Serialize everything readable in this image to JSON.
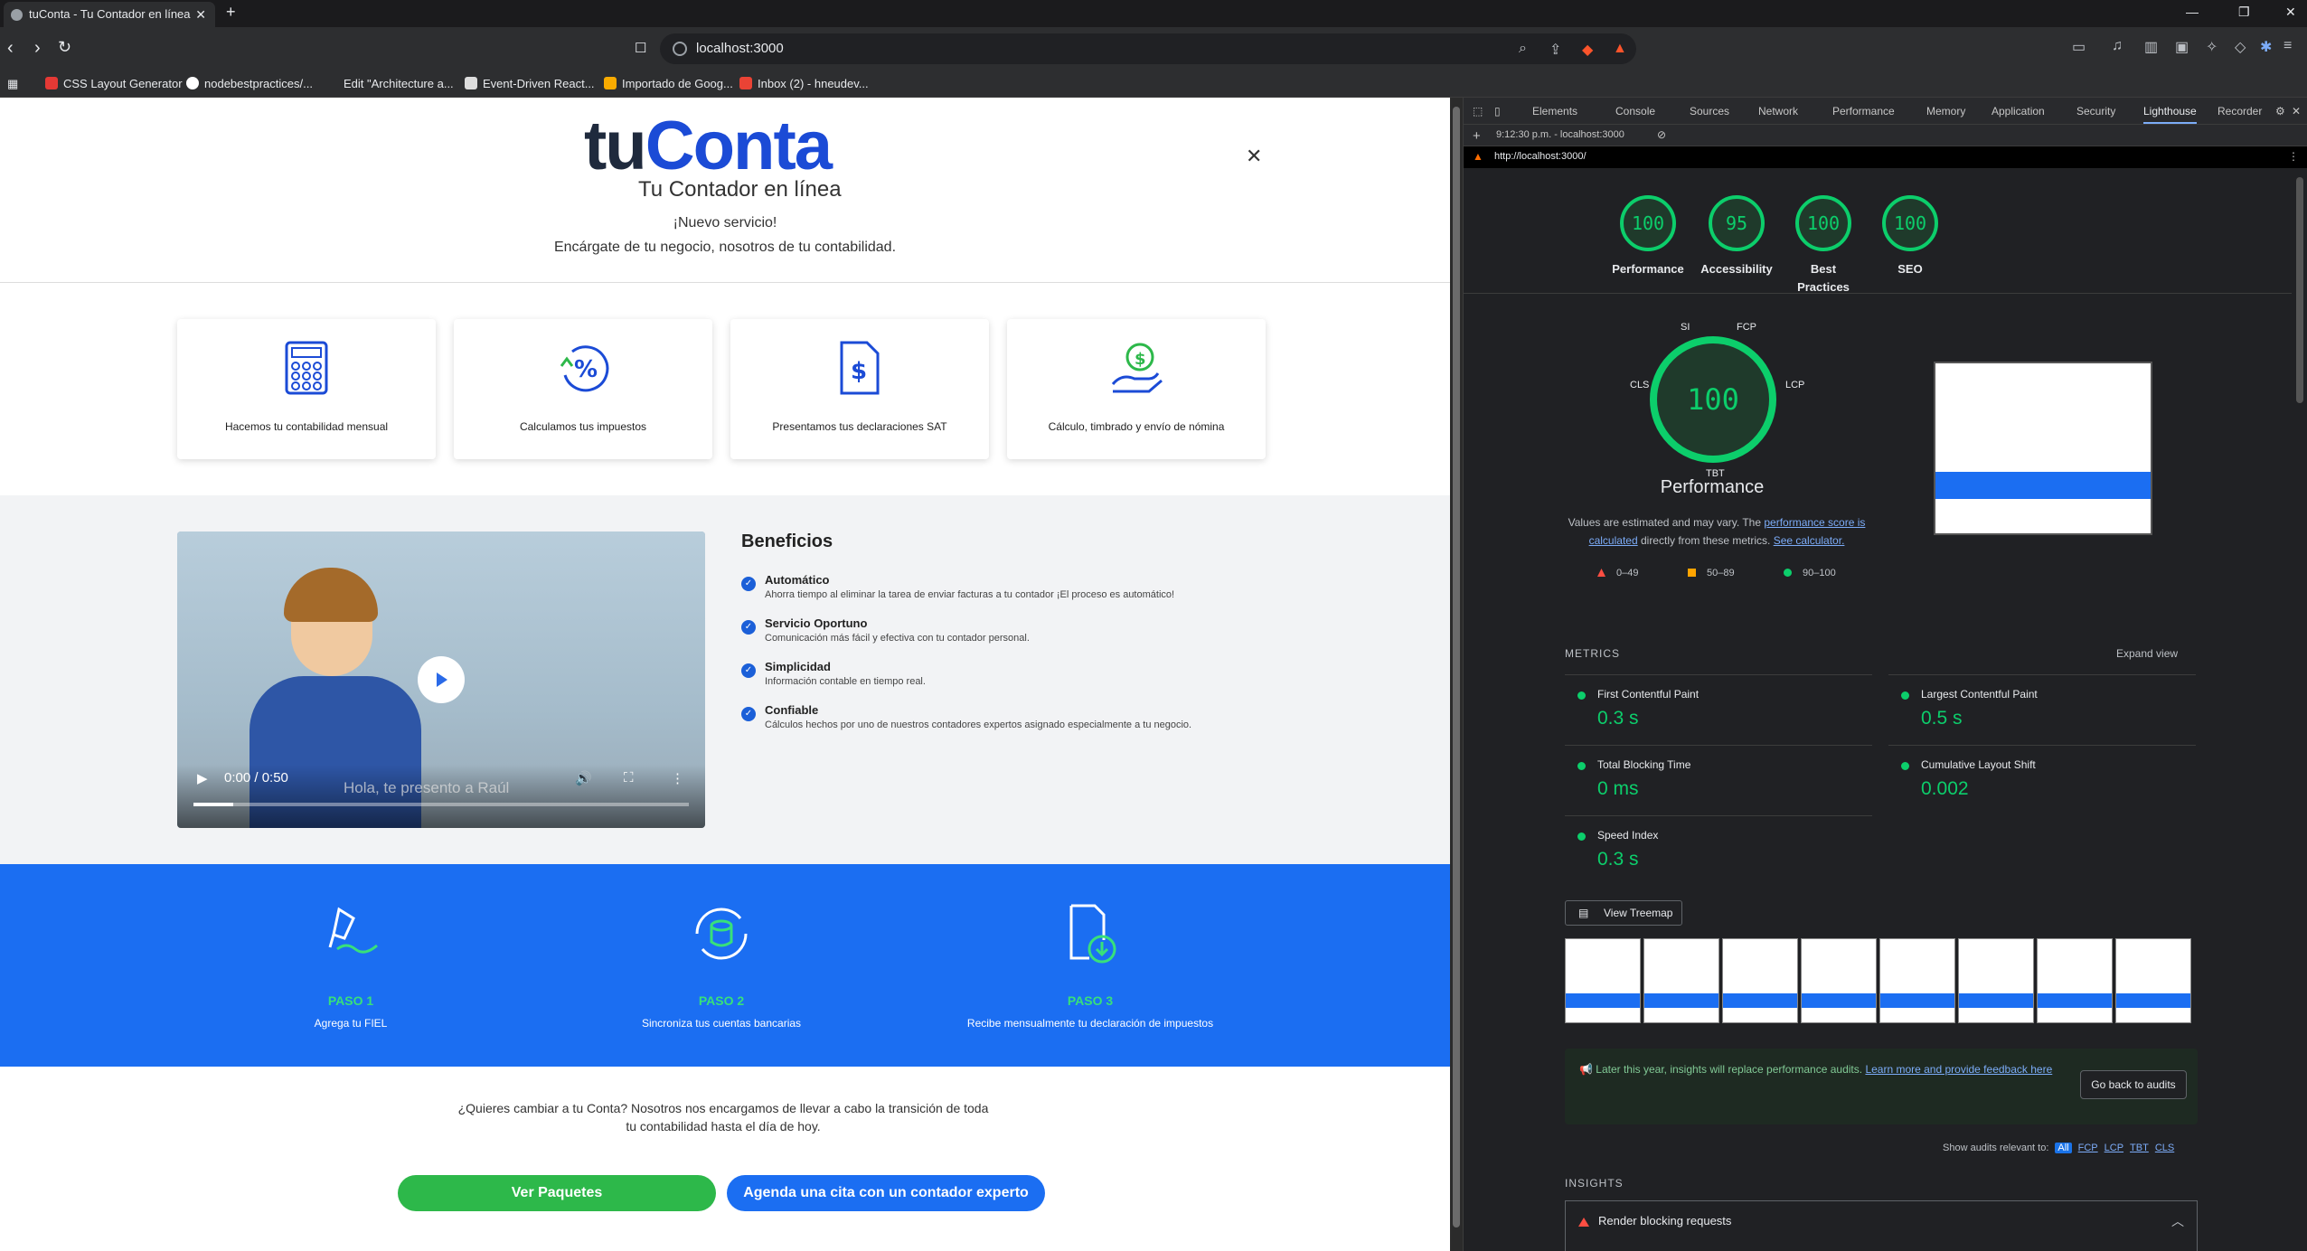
{
  "browser": {
    "tab_title": "tuConta - Tu Contador en línea",
    "url": "localhost:3000",
    "bookmarks": [
      "CSS Layout Generator",
      "nodebestpractices/...",
      "Edit \"Architecture a...",
      "Event-Driven React...",
      "Importado de Goog...",
      "Inbox (2) - hneudev..."
    ]
  },
  "site": {
    "logo_tu": "tu",
    "logo_conta": "Conta",
    "tagline": "Tu Contador en línea",
    "header_line1": "¡Nuevo servicio!",
    "header_line2": "Encárgate de tu negocio, nosotros de tu contabilidad.",
    "services": [
      "Hacemos tu contabilidad mensual",
      "Calculamos tus impuestos",
      "Presentamos tus declaraciones SAT",
      "Cálculo, timbrado y envío de nómina"
    ],
    "video": {
      "time": "0:00 / 0:50",
      "subtitle": "Hola, te presento a Raúl",
      "progress": 0.08
    },
    "benefits_title": "Beneficios",
    "benefits": [
      {
        "title": "Automático",
        "desc": "Ahorra tiempo al eliminar la tarea de enviar facturas a tu contador ¡El proceso es automático!"
      },
      {
        "title": "Servicio Oportuno",
        "desc": "Comunicación más fácil y efectiva con tu contador personal."
      },
      {
        "title": "Simplicidad",
        "desc": "Información contable en tiempo real."
      },
      {
        "title": "Confiable",
        "desc": "Cálculos hechos por uno de nuestros contadores expertos asignado especialmente a tu negocio."
      }
    ],
    "steps": [
      {
        "label": "PASO 1",
        "desc": "Agrega tu FIEL"
      },
      {
        "label": "PASO 2",
        "desc": "Sincroniza tus cuentas bancarias"
      },
      {
        "label": "PASO 3",
        "desc": "Recibe mensualmente tu declaración de impuestos"
      }
    ],
    "cta_text": "¿Quieres cambiar a tu Conta? Nosotros nos encargamos de llevar a cabo la transición de toda tu contabilidad hasta el día de hoy.",
    "btn_packages": "Ver Paquetes",
    "btn_appointment": "Agenda una cita con un contador experto",
    "colors": {
      "brand_blue": "#1b6ef2",
      "cta_green": "#2db84a",
      "step_green": "#38e07b"
    }
  },
  "devtools": {
    "tabs": [
      "Elements",
      "Console",
      "Sources",
      "Network",
      "Performance",
      "Memory",
      "Application",
      "Security",
      "Lighthouse",
      "Recorder"
    ],
    "active_tab": "Lighthouse",
    "report_time": "9:12:30 p.m. - localhost:3000",
    "report_url": "http://localhost:3000/",
    "scores": [
      {
        "label": "Performance",
        "value": "100"
      },
      {
        "label": "Accessibility",
        "value": "95"
      },
      {
        "label": "Best Practices",
        "value": "100"
      },
      {
        "label": "SEO",
        "value": "100"
      }
    ],
    "big_score": "100",
    "big_label": "Performance",
    "gauge_labels": {
      "si": "SI",
      "fcp": "FCP",
      "lcp": "LCP",
      "tbt": "TBT",
      "cls": "CLS"
    },
    "note_a": "Values are estimated and may vary. The ",
    "note_link1": "performance score is calculated",
    "note_b": " directly from these metrics. ",
    "note_link2": "See calculator.",
    "legend": [
      "0–49",
      "50–89",
      "90–100"
    ],
    "metrics_heading": "METRICS",
    "expand": "Expand view",
    "metrics": [
      {
        "name": "First Contentful Paint",
        "value": "0.3 s"
      },
      {
        "name": "Largest Contentful Paint",
        "value": "0.5 s"
      },
      {
        "name": "Total Blocking Time",
        "value": "0 ms"
      },
      {
        "name": "Cumulative Layout Shift",
        "value": "0.002"
      },
      {
        "name": "Speed Index",
        "value": "0.3 s"
      }
    ],
    "treemap": "View Treemap",
    "insight_note": "Later this year, insights will replace performance audits. ",
    "insight_link": "Learn more and provide feedback here",
    "go_back": "Go back to audits",
    "show_audits": "Show audits relevant to:",
    "audit_filters": [
      "All",
      "FCP",
      "LCP",
      "TBT",
      "CLS"
    ],
    "insights_heading": "INSIGHTS",
    "render_blocking": "Render blocking requests"
  }
}
